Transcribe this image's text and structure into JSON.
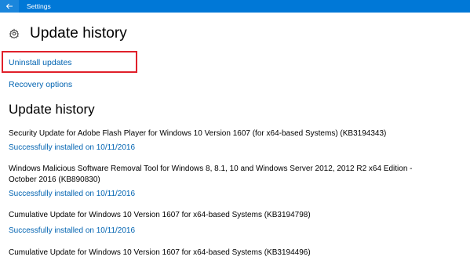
{
  "window": {
    "title": "Settings"
  },
  "header": {
    "title": "Update history",
    "icon": "gear-icon"
  },
  "links": {
    "uninstall": "Uninstall updates",
    "recovery": "Recovery options"
  },
  "section": {
    "title": "Update history"
  },
  "updates": [
    {
      "name": "Security Update for Adobe Flash Player for Windows 10 Version 1607 (for x64-based Systems) (KB3194343)",
      "status": "Successfully installed on 10/11/2016"
    },
    {
      "name": "Windows Malicious Software Removal Tool for Windows 8, 8.1, 10 and Windows Server 2012, 2012 R2 x64 Edition -",
      "name_line2": "October 2016 (KB890830)",
      "status": "Successfully installed on 10/11/2016"
    },
    {
      "name": "Cumulative Update for Windows 10 Version 1607 for x64-based Systems (KB3194798)",
      "status": "Successfully installed on 10/11/2016"
    },
    {
      "name": "Cumulative Update for Windows 10 Version 1607 for x64-based Systems (KB3194496)"
    }
  ],
  "colors": {
    "titlebar": "#0078d7",
    "link": "#0063b1",
    "highlight": "#e0202a"
  }
}
